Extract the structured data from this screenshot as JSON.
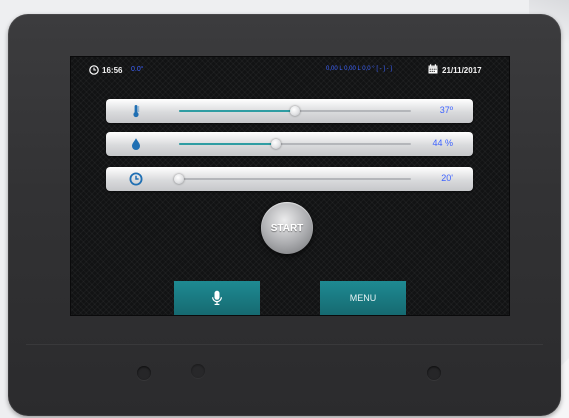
{
  "status_bar": {
    "time": "16:56",
    "temperature": "0.0°",
    "readings": "0,00 L  0,00 L  0,0 ° [ - ] - ]",
    "date": "21/11/2017",
    "icons": [
      "clock-icon",
      "calendar-icon"
    ]
  },
  "controls": [
    {
      "name": "temperature",
      "icon": "thermometer-icon",
      "value": "37º",
      "level": 0.5
    },
    {
      "name": "humidity",
      "icon": "water-drop-icon",
      "value": "44 %",
      "level": 0.42
    },
    {
      "name": "time",
      "icon": "clock-icon",
      "value": "20'",
      "level": 0.0
    }
  ],
  "start_button": {
    "label": "START"
  },
  "bottom_bar": {
    "mic_icon": "microphone-icon",
    "menu_label": "MENU"
  },
  "colors": {
    "accent_teal": "#1e8a92",
    "value_blue": "#3e63ff",
    "slider_fill": "#2f9da3",
    "device_body": "#333335"
  }
}
